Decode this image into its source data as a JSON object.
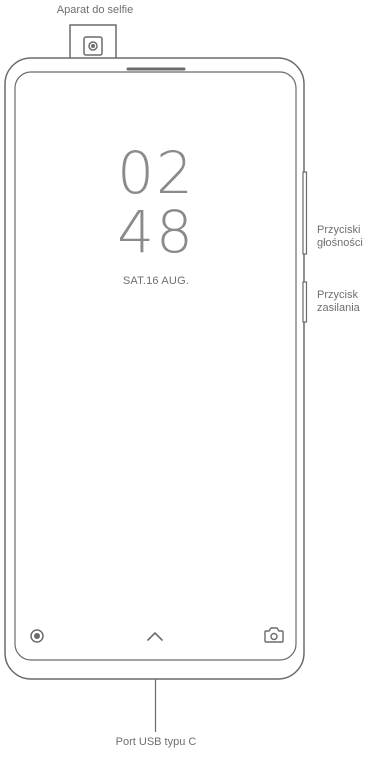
{
  "labels": {
    "selfie_camera": "Aparat do selfie",
    "volume_buttons_line1": "Przyciski",
    "volume_buttons_line2": "głośności",
    "power_button_line1": "Przycisk",
    "power_button_line2": "zasilania",
    "usb_port": "Port USB typu C"
  },
  "lockscreen": {
    "hours": "02",
    "minutes": "48",
    "date": "SAT.16 AUG."
  },
  "icons": {
    "bottom_left": "record-icon",
    "bottom_center": "chevron-up-icon",
    "bottom_right": "camera-icon"
  },
  "colors": {
    "outline": "#6b6b6b",
    "background": "#ffffff"
  }
}
